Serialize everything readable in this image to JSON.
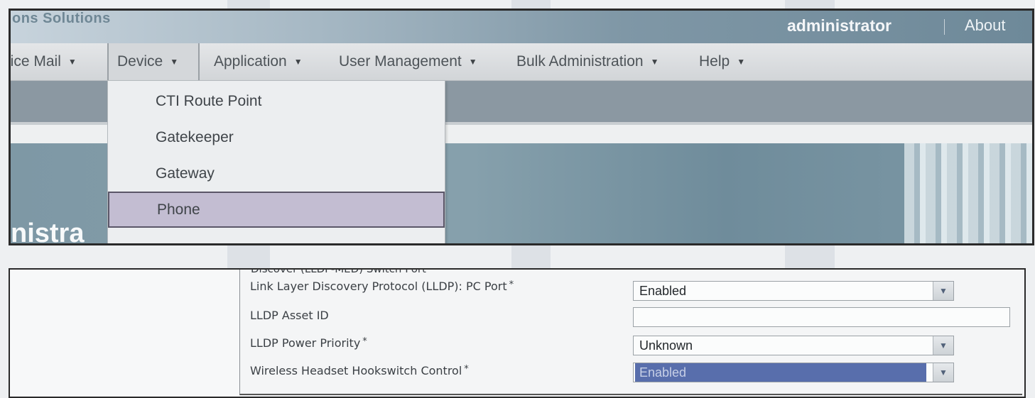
{
  "header": {
    "brand_text": "ons Solutions",
    "user": "administrator",
    "about": "About"
  },
  "menu": [
    {
      "label": "pice Mail"
    },
    {
      "label": "Device"
    },
    {
      "label": "Application"
    },
    {
      "label": "User Management"
    },
    {
      "label": "Bulk Administration"
    },
    {
      "label": "Help"
    }
  ],
  "device_menu": {
    "items": [
      "CTI Route Point",
      "Gatekeeper",
      "Gateway",
      "Phone"
    ],
    "highlighted": "Phone"
  },
  "banner_text": "nistra",
  "form": {
    "section_title": "Discover (LLDP-MED) Switch Port",
    "fields": [
      {
        "label": "Link Layer Discovery Protocol (LLDP): PC Port",
        "required": true,
        "type": "select",
        "value": "Enabled"
      },
      {
        "label": "LLDP Asset ID",
        "required": false,
        "type": "text",
        "value": ""
      },
      {
        "label": "LLDP Power Priority",
        "required": true,
        "type": "select",
        "value": "Unknown"
      },
      {
        "label": "Wireless Headset Hookswitch Control",
        "required": true,
        "type": "select",
        "value": "Enabled",
        "focused": true
      }
    ]
  },
  "colors": {
    "brand_bar": "#7f97a6",
    "menu_hover": "#c3bdd2",
    "select_highlight": "#586eac"
  }
}
